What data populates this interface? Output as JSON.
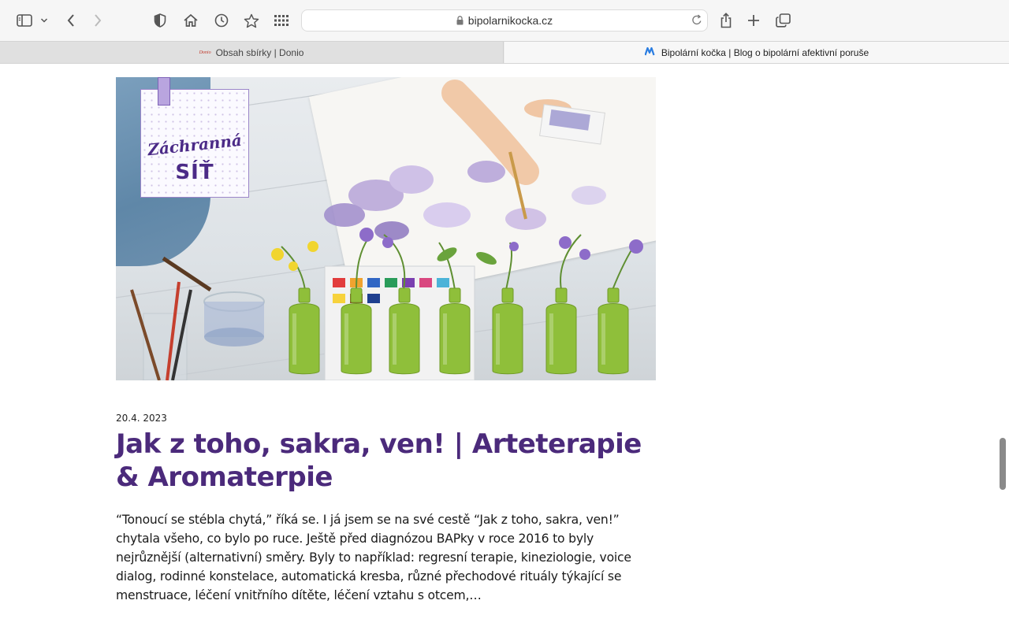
{
  "browser": {
    "url": "bipolarnikocka.cz",
    "tabs": [
      {
        "label": "Obsah sbírky | Donio",
        "favicon_text": "Donio",
        "active": false
      },
      {
        "label": "Bipolární kočka | Blog o bipolární afektivní poruše",
        "active": true
      }
    ],
    "icons": [
      "sidebar-icon",
      "chevron-down-icon",
      "back-icon",
      "forward-icon",
      "shield-icon",
      "home-icon",
      "history-icon",
      "star-icon",
      "grid-icon",
      "lock-icon",
      "reload-icon",
      "share-icon",
      "plus-icon",
      "tabs-icon"
    ]
  },
  "hero": {
    "sign_script": "Záchranná",
    "sign_title": "SÍŤ",
    "colors": {
      "accent": "#4b2a87",
      "bottle": "#8fbf3a"
    }
  },
  "post": {
    "date": "20.4. 2023",
    "title": "Jak z toho, sakra, ven! | Arteterapie & Aromaterpie",
    "excerpt": "“Tonoucí se stébla chytá,” říká se. I já jsem se na své cestě “Jak z toho, sakra, ven!” chytala všeho, co bylo po ruce. Ještě před diagnózou BAPky v roce 2016 to byly nejrůznější (alternativní) směry. Byly to například: regresní terapie, kineziologie, voice dialog, rodinné konstelace, automatická kresba, různé přechodové rituály týkající se menstruace, léčení vnitřního dítěte, léčení vztahu s otcem,…"
  }
}
